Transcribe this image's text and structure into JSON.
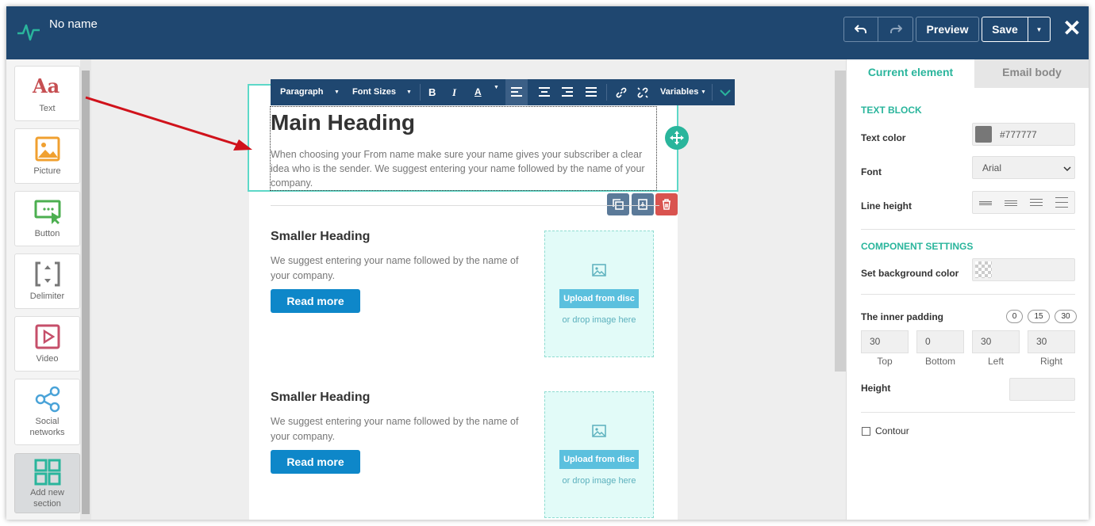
{
  "app": {
    "title": "No name"
  },
  "toolbar": {
    "preview": "Preview",
    "save": "Save",
    "close": "✕"
  },
  "tools": [
    {
      "label": "Text",
      "icon": "text-aa-icon"
    },
    {
      "label": "Picture",
      "icon": "picture-icon"
    },
    {
      "label": "Button",
      "icon": "button-icon"
    },
    {
      "label": "Delimiter",
      "icon": "delimiter-icon"
    },
    {
      "label": "Video",
      "icon": "video-icon"
    },
    {
      "label": "Social networks",
      "icon": "share-icon"
    },
    {
      "label": "Add new section",
      "icon": "grid-icon"
    }
  ],
  "editor_toolbar": {
    "paragraph": "Paragraph",
    "font_sizes": "Font Sizes",
    "bold": "B",
    "italic": "I",
    "font_color": "A",
    "variables": "Variables"
  },
  "email": {
    "main_heading": "Main Heading",
    "main_text": "When choosing your From name make sure your name gives your subscriber a clear idea who is the sender. We suggest entering your name followed by the name of your company.",
    "cards": [
      {
        "heading": "Smaller Heading",
        "text": "We suggest entering your name followed by the name of your company.",
        "button": "Read more",
        "upload": "Upload from disc",
        "drop": "or drop image here"
      },
      {
        "heading": "Smaller Heading",
        "text": "We suggest entering your name followed by the name of your company.",
        "button": "Read more",
        "upload": "Upload from disc",
        "drop": "or drop image here"
      }
    ]
  },
  "panel": {
    "tabs": {
      "current": "Current element",
      "body": "Email body"
    },
    "text_block": "TEXT BLOCK",
    "text_color_label": "Text color",
    "text_color_value": "#777777",
    "font_label": "Font",
    "font_value": "Arial",
    "line_height_label": "Line height",
    "component_settings": "COMPONENT SETTINGS",
    "bg_color_label": "Set background color",
    "inner_padding_label": "The inner padding",
    "padding_presets": [
      "0",
      "15",
      "30"
    ],
    "padding": [
      {
        "value": "30",
        "label": "Top"
      },
      {
        "value": "0",
        "label": "Bottom"
      },
      {
        "value": "30",
        "label": "Left"
      },
      {
        "value": "30",
        "label": "Right"
      }
    ],
    "height_label": "Height",
    "contour_label": "Contour"
  },
  "colors": {
    "topbar": "#1f4770",
    "accent": "#2ab59c",
    "button_blue": "#0e87c9",
    "selection": "#5dd8c8",
    "annotation_arrow": "#d0121b"
  }
}
